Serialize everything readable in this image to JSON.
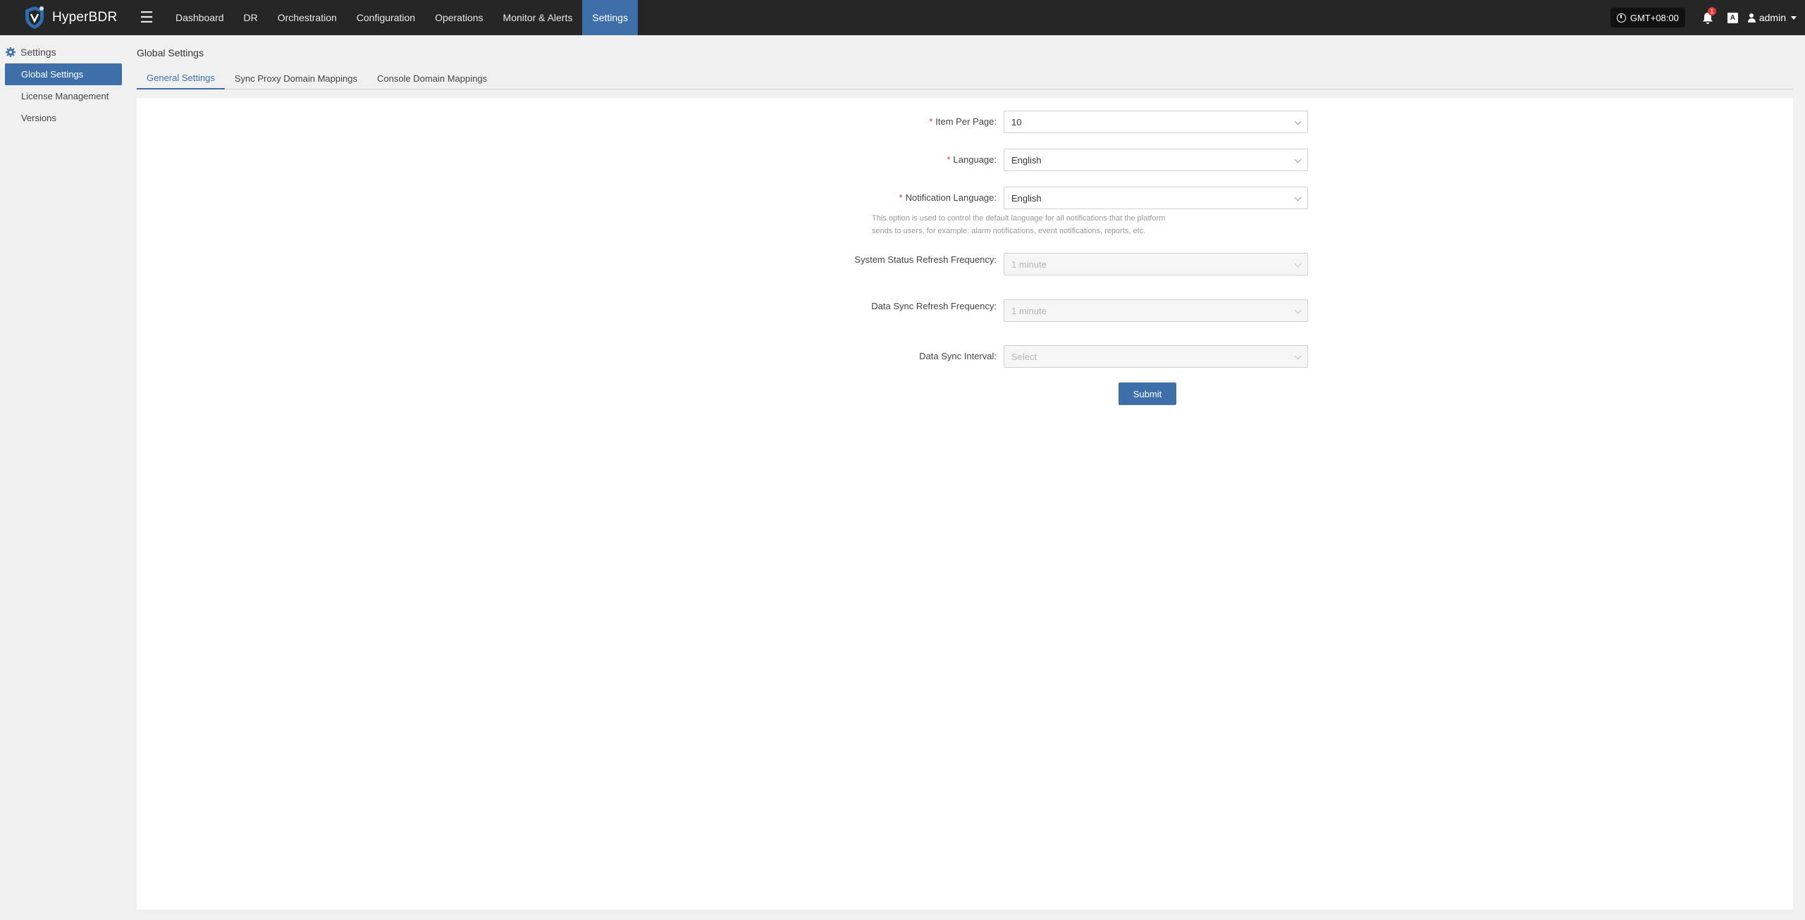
{
  "app": {
    "name": "HyperBDR"
  },
  "nav": {
    "items": [
      {
        "label": "Dashboard",
        "active": false
      },
      {
        "label": "DR",
        "active": false
      },
      {
        "label": "Orchestration",
        "active": false
      },
      {
        "label": "Configuration",
        "active": false
      },
      {
        "label": "Operations",
        "active": false
      },
      {
        "label": "Monitor & Alerts",
        "active": false
      },
      {
        "label": "Settings",
        "active": true
      }
    ]
  },
  "topright": {
    "timezone": "GMT+08:00",
    "notification_count": "1",
    "lang_icon": "A",
    "user": "admin"
  },
  "sidebar": {
    "header": "Settings",
    "items": [
      {
        "label": "Global Settings",
        "active": true
      },
      {
        "label": "License Management",
        "active": false
      },
      {
        "label": "Versions",
        "active": false
      }
    ]
  },
  "main": {
    "title": "Global Settings",
    "tabs": [
      {
        "label": "General Settings",
        "active": true
      },
      {
        "label": "Sync Proxy Domain Mappings",
        "active": false
      },
      {
        "label": "Console Domain Mappings",
        "active": false
      }
    ]
  },
  "form": {
    "item_per_page": {
      "label": "Item Per Page:",
      "value": "10",
      "required": true
    },
    "language": {
      "label": "Language:",
      "value": "English",
      "required": true
    },
    "notification_language": {
      "label": "Notification Language:",
      "value": "English",
      "required": true,
      "help": "This option is used to control the default language for all notifications that the platform sends to users, for example: alarm notifications, event notifications, reports, etc."
    },
    "system_status_refresh": {
      "label": "System Status Refresh Frequency:",
      "value": "1 minute",
      "disabled": true
    },
    "data_sync_refresh": {
      "label": "Data Sync Refresh Frequency:",
      "value": "1 minute",
      "disabled": true
    },
    "data_sync_interval": {
      "label": "Data Sync Interval:",
      "placeholder": "Select",
      "disabled": true
    },
    "submit_label": "Submit"
  },
  "icons": {
    "logo": "shield-logo-icon",
    "menu": "hamburger-icon",
    "clock": "clock-icon",
    "bell": "bell-icon",
    "language": "language-icon",
    "user": "user-icon",
    "settings": "gear-icon",
    "dropdown": "chevron-down-icon"
  },
  "colors": {
    "topbar": "#262626",
    "accent": "#3f6fa8",
    "badge": "#e03b3b",
    "background": "#f0f0f0"
  }
}
